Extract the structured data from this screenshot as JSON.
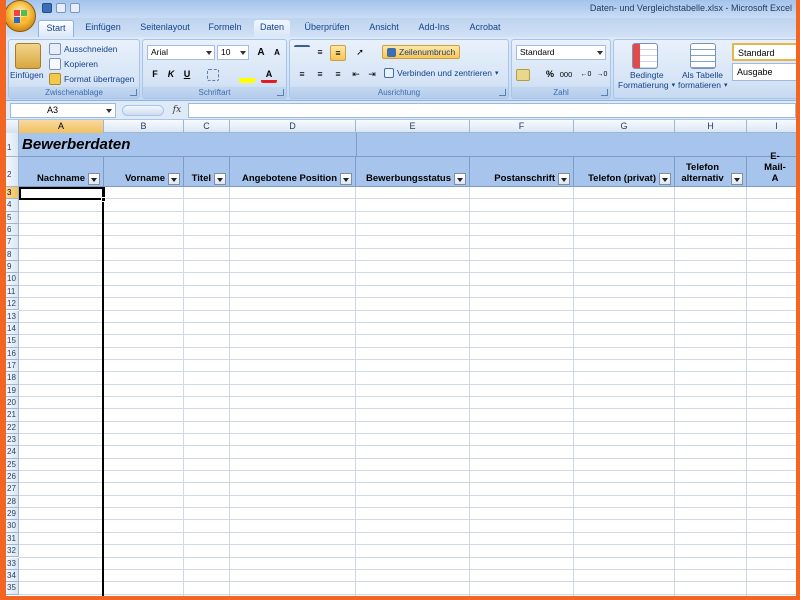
{
  "window": {
    "title": "Daten- und Vergleichstabelle.xlsx - Microsoft Excel"
  },
  "tabs": [
    {
      "label": "Start",
      "active": true
    },
    {
      "label": "Einfügen"
    },
    {
      "label": "Seitenlayout"
    },
    {
      "label": "Formeln"
    },
    {
      "label": "Daten",
      "hover": true
    },
    {
      "label": "Überprüfen"
    },
    {
      "label": "Ansicht"
    },
    {
      "label": "Add-Ins"
    },
    {
      "label": "Acrobat"
    }
  ],
  "ribbon": {
    "clipboard": {
      "group_label": "Zwischenablage",
      "paste_label": "Einfügen",
      "cut_label": "Ausschneiden",
      "copy_label": "Kopieren",
      "format_painter_label": "Format übertragen"
    },
    "font": {
      "group_label": "Schriftart",
      "font_name": "Arial",
      "font_size": "10",
      "grow": "A",
      "shrink": "A",
      "bold": "F",
      "italic": "K",
      "underline": "U",
      "font_color_glyph": "A"
    },
    "alignment": {
      "group_label": "Ausrichtung",
      "wrap_text_label": "Zeilenumbruch",
      "merge_label": "Verbinden und zentrieren"
    },
    "number": {
      "group_label": "Zahl",
      "format": "Standard",
      "percent": "%",
      "thousands": "000"
    },
    "styles": {
      "conditional_label_1": "Bedingte",
      "conditional_label_2": "Formatierung",
      "as_table_label_1": "Als Tabelle",
      "as_table_label_2": "formatieren",
      "style_1": "Standard",
      "style_2": "Ausgabe"
    }
  },
  "formula_bar": {
    "name_box": "A3",
    "fx": "fx",
    "value": ""
  },
  "sheet": {
    "columns": [
      "A",
      "B",
      "C",
      "D",
      "E",
      "F",
      "G",
      "H",
      "I"
    ],
    "active_column": "A",
    "active_row": "3",
    "title": "Bewerberdaten",
    "headers": [
      {
        "col": "A",
        "label": "Nachname"
      },
      {
        "col": "B",
        "label": "Vorname"
      },
      {
        "col": "C",
        "label": "Titel"
      },
      {
        "col": "D",
        "label": "Angebotene Position"
      },
      {
        "col": "E",
        "label": "Bewerbungsstatus"
      },
      {
        "col": "F",
        "label": "Postanschrift"
      },
      {
        "col": "G",
        "label": "Telefon (privat)"
      },
      {
        "col": "H",
        "label": "Telefon alternativ"
      },
      {
        "col": "I",
        "label": "E-Mail-A"
      }
    ],
    "row_numbers": [
      "1",
      "2",
      "3",
      "4",
      "5",
      "6",
      "7",
      "8",
      "9",
      "10",
      "11",
      "12",
      "13",
      "14",
      "15",
      "16",
      "17",
      "18",
      "19",
      "20",
      "21",
      "22",
      "23",
      "24",
      "25",
      "26",
      "27",
      "28",
      "29",
      "30",
      "31",
      "32",
      "33",
      "34",
      "35"
    ]
  },
  "colors": {
    "header_fill": "#a6c4ec",
    "ribbon_blue": "#d4e3f6",
    "frame_orange": "#f26522"
  }
}
